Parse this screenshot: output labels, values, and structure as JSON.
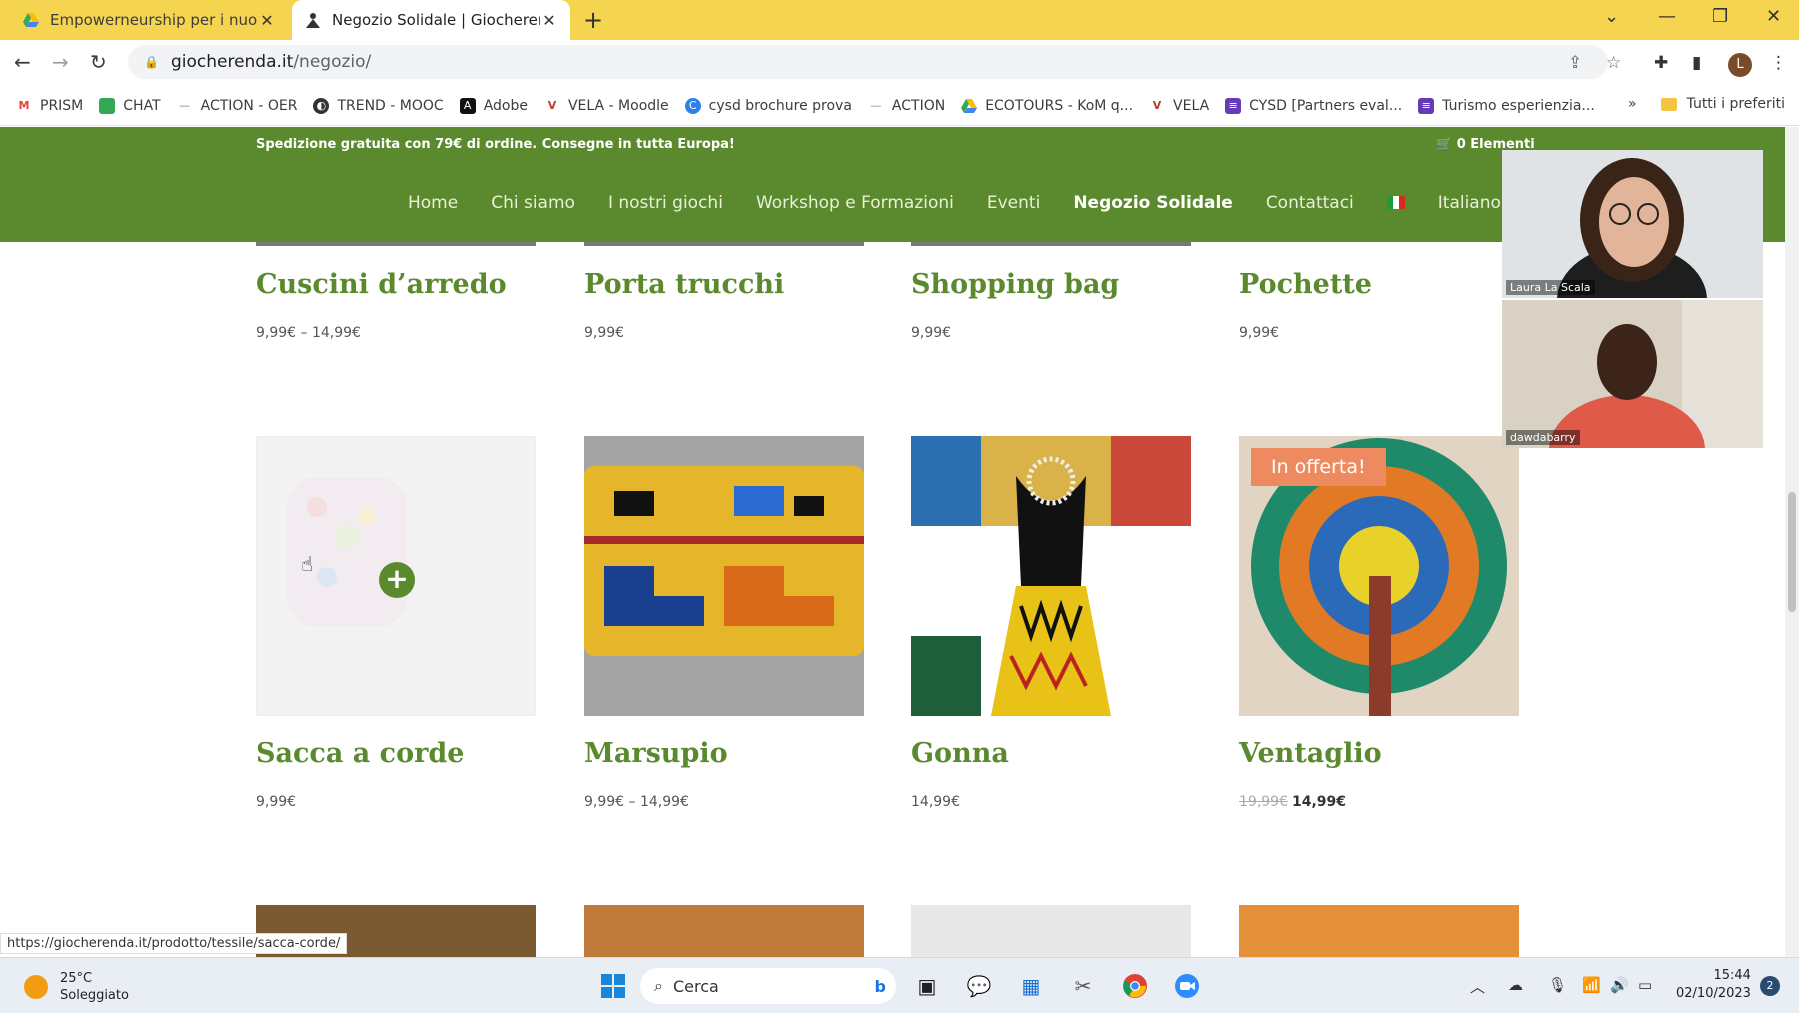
{
  "browser": {
    "tabs": [
      {
        "title": "Empowerneurship per i nuovi ar",
        "active": false
      },
      {
        "title": "Negozio Solidale | Giocherenda",
        "active": true
      }
    ],
    "url_host": "giocherenda.it",
    "url_path": "/negozio/",
    "profile_initial": "L",
    "bookmarks": [
      {
        "label": "PRISM",
        "icon": "gmail-icon"
      },
      {
        "label": "CHAT",
        "icon": "chat-icon"
      },
      {
        "label": "ACTION - OER",
        "icon": "dash-icon"
      },
      {
        "label": "TREND - MOOC",
        "icon": "globe-icon"
      },
      {
        "label": "Adobe",
        "icon": "adobe-icon"
      },
      {
        "label": "VELA - Moodle",
        "icon": "vela-icon"
      },
      {
        "label": "cysd brochure prova",
        "icon": "canva-icon"
      },
      {
        "label": "ACTION",
        "icon": "dash-icon"
      },
      {
        "label": "ECOTOURS - KoM q...",
        "icon": "drive-icon"
      },
      {
        "label": "VELA",
        "icon": "vela-icon"
      },
      {
        "label": "CYSD [Partners eval...",
        "icon": "forms-icon"
      },
      {
        "label": "Turismo esperienzia...",
        "icon": "forms-icon"
      }
    ],
    "bookmarks_overflow": "»",
    "bookmarks_folder": "Tutti i preferiti",
    "status_url": "https://giocherenda.it/prodotto/tessile/sacca-corde/"
  },
  "site": {
    "shipping_notice": "Spedizione gratuita con 79€ di ordine. Consegne in tutta Europa!",
    "cart_label": "0 Elementi",
    "menu": [
      "Home",
      "Chi siamo",
      "I nostri giochi",
      "Workshop e Formazioni",
      "Eventi",
      "Negozio Solidale",
      "Contattaci",
      "Italiano"
    ],
    "menu_current": "Negozio Solidale"
  },
  "products": {
    "row1": [
      {
        "title": "Cuscini d’arredo",
        "price": "9,99€ – 14,99€"
      },
      {
        "title": "Porta trucchi",
        "price": "9,99€"
      },
      {
        "title": "Shopping bag",
        "price": "9,99€"
      },
      {
        "title": "Pochette",
        "price": "9,99€"
      }
    ],
    "row2": [
      {
        "title": "Sacca a corde",
        "price": "9,99€"
      },
      {
        "title": "Marsupio",
        "price": "9,99€ – 14,99€"
      },
      {
        "title": "Gonna",
        "price": "14,99€"
      },
      {
        "title": "Ventaglio",
        "old_price": "19,99€",
        "price": "14,99€",
        "badge": "In offerta!"
      }
    ]
  },
  "call": {
    "participants": [
      "Laura La Scala",
      "dawdabarry"
    ]
  },
  "taskbar": {
    "temperature": "25°C",
    "weather": "Soleggiato",
    "search_placeholder": "Cerca",
    "time": "15:44",
    "date": "02/10/2023",
    "notifications": "2"
  },
  "colors": {
    "chrome_frame": "#f5d54f",
    "site_green": "#5a8a2d",
    "sale_badge": "#ee8a5f"
  }
}
